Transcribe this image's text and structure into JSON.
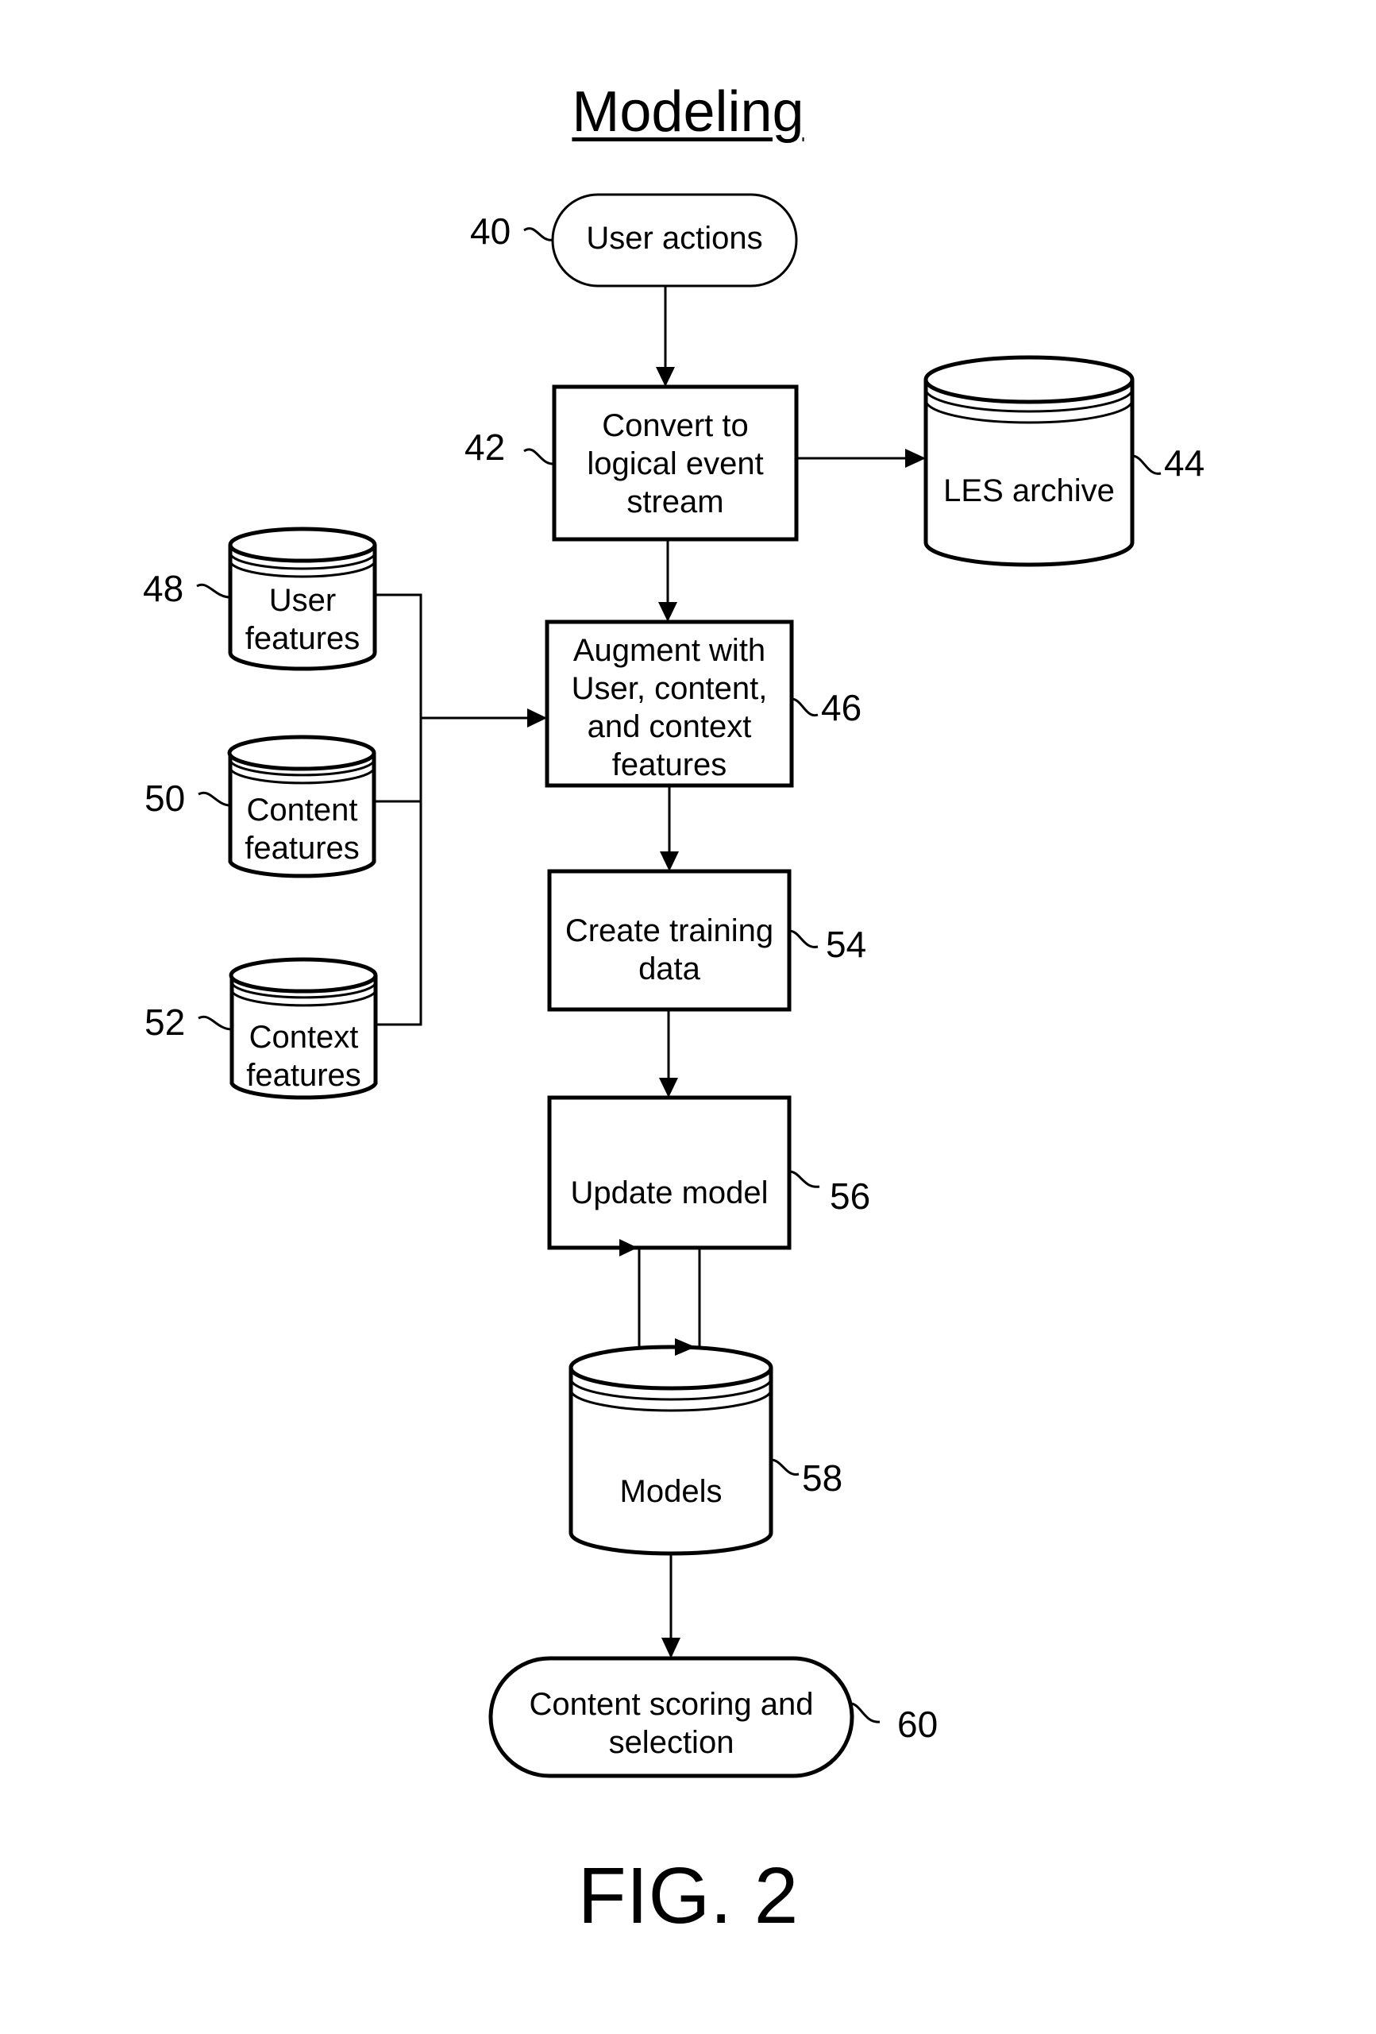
{
  "title": "Modeling",
  "figure_label": "FIG. 2",
  "nodes": {
    "user_actions": {
      "ref": "40",
      "lines": [
        "User actions"
      ],
      "shape": "terminator"
    },
    "convert": {
      "ref": "42",
      "lines": [
        "Convert to",
        "logical event",
        "stream"
      ],
      "shape": "process"
    },
    "les_archive": {
      "ref": "44",
      "lines": [
        "LES archive"
      ],
      "shape": "datastore"
    },
    "augment": {
      "ref": "46",
      "lines": [
        "Augment with",
        "User, content,",
        "and context",
        "features"
      ],
      "shape": "process"
    },
    "user_features": {
      "ref": "48",
      "lines": [
        "User",
        "features"
      ],
      "shape": "datastore"
    },
    "content_features": {
      "ref": "50",
      "lines": [
        "Content",
        "features"
      ],
      "shape": "datastore"
    },
    "context_features": {
      "ref": "52",
      "lines": [
        "Context",
        "features"
      ],
      "shape": "datastore"
    },
    "create_training": {
      "ref": "54",
      "lines": [
        "Create training",
        "data"
      ],
      "shape": "process"
    },
    "update_model": {
      "ref": "56",
      "lines": [
        "Update model"
      ],
      "shape": "process"
    },
    "models": {
      "ref": "58",
      "lines": [
        "Models"
      ],
      "shape": "datastore"
    },
    "content_scoring": {
      "ref": "60",
      "lines": [
        "Content scoring and",
        "selection"
      ],
      "shape": "terminator"
    }
  },
  "edges": [
    {
      "from": "user_actions",
      "to": "convert"
    },
    {
      "from": "convert",
      "to": "les_archive"
    },
    {
      "from": "convert",
      "to": "augment"
    },
    {
      "from": "user_features",
      "to": "augment"
    },
    {
      "from": "content_features",
      "to": "augment"
    },
    {
      "from": "context_features",
      "to": "augment"
    },
    {
      "from": "augment",
      "to": "create_training"
    },
    {
      "from": "create_training",
      "to": "update_model"
    },
    {
      "from": "update_model",
      "to": "models"
    },
    {
      "from": "models",
      "to": "update_model"
    },
    {
      "from": "models",
      "to": "content_scoring"
    }
  ]
}
